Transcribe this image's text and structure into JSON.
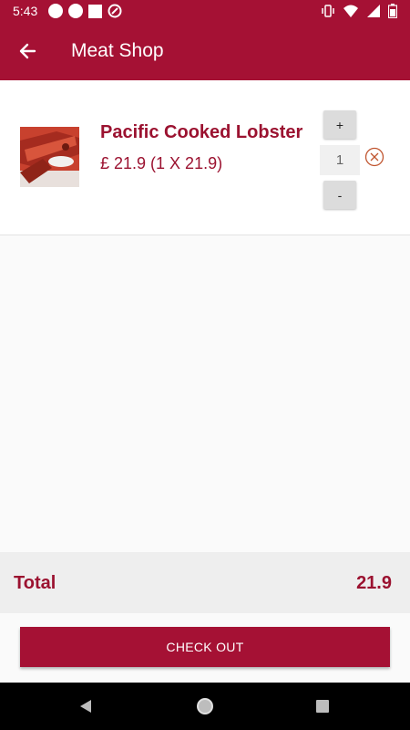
{
  "status_bar": {
    "time": "5:43"
  },
  "app_bar": {
    "title": "Meat Shop"
  },
  "cart": {
    "items": [
      {
        "name": "Pacific Cooked Lobster",
        "price_text": "£ 21.9 (1 X 21.9)",
        "quantity": "1",
        "plus_label": "+",
        "minus_label": "-"
      }
    ]
  },
  "summary": {
    "total_label": "Total",
    "total_value": "21.9"
  },
  "checkout": {
    "label": "CHECK OUT"
  },
  "colors": {
    "brand": "#a51134",
    "text_accent": "#9b1230"
  },
  "icons": {
    "back": "arrow-left-icon",
    "remove": "remove-circle-x-icon",
    "nav_back": "triangle-back-icon",
    "nav_home": "circle-home-icon",
    "nav_recents": "square-recents-icon"
  }
}
